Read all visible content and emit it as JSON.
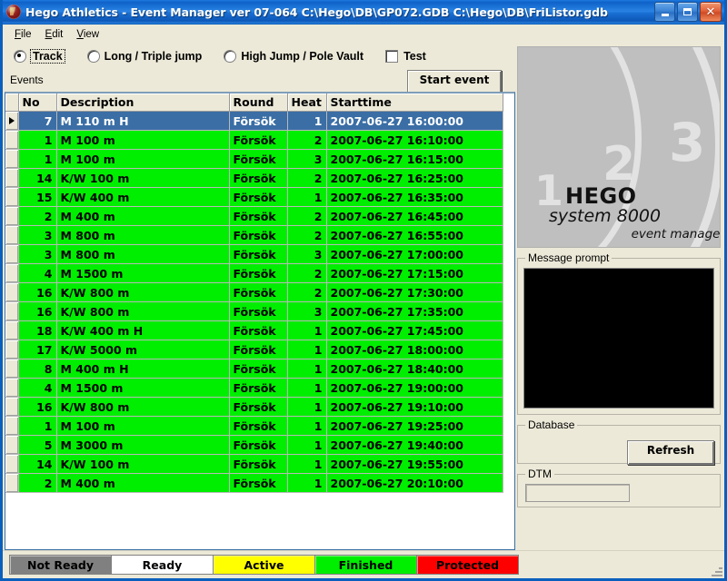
{
  "window": {
    "title": "Hego Athletics - Event Manager ver 07-064  C:\\Hego\\DB\\GP072.GDB C:\\Hego\\DB\\FriListor.gdb",
    "icon": "hego-app-icon",
    "minimize_label": "",
    "maximize_label": "",
    "close_label": "✕",
    "titlebar_color": "#1569cf",
    "frame_color": "#0a5fbd"
  },
  "menu": {
    "items": [
      {
        "label": "File",
        "accel": "F",
        "rest": "ile"
      },
      {
        "label": "Edit",
        "accel": "E",
        "rest": "dit"
      },
      {
        "label": "View",
        "accel": "V",
        "rest": "iew"
      }
    ]
  },
  "options": {
    "radios": [
      {
        "label": "Track",
        "selected": true,
        "focused": true
      },
      {
        "label": "Long / Triple jump",
        "selected": false,
        "focused": false
      },
      {
        "label": "High Jump / Pole Vault",
        "selected": false,
        "focused": false
      }
    ],
    "checkbox": {
      "label": "Test",
      "checked": false
    }
  },
  "events_panel": {
    "label": "Events",
    "start_button": "Start event"
  },
  "grid": {
    "columns": [
      "No",
      "Description",
      "Round",
      "Heat",
      "Starttime"
    ],
    "selected_row_index": 0,
    "selected_color": "#3a6ea5",
    "row_color": "#00ee00",
    "rows": [
      {
        "no": "7",
        "description": "M 110 m H",
        "round": "Försök",
        "heat": "1",
        "starttime": "2007-06-27 16:00:00"
      },
      {
        "no": "1",
        "description": "M 100 m",
        "round": "Försök",
        "heat": "2",
        "starttime": "2007-06-27 16:10:00"
      },
      {
        "no": "1",
        "description": "M 100 m",
        "round": "Försök",
        "heat": "3",
        "starttime": "2007-06-27 16:15:00"
      },
      {
        "no": "14",
        "description": "K/W 100 m",
        "round": "Försök",
        "heat": "2",
        "starttime": "2007-06-27 16:25:00"
      },
      {
        "no": "15",
        "description": "K/W 400 m",
        "round": "Försök",
        "heat": "1",
        "starttime": "2007-06-27 16:35:00"
      },
      {
        "no": "2",
        "description": "M 400 m",
        "round": "Försök",
        "heat": "2",
        "starttime": "2007-06-27 16:45:00"
      },
      {
        "no": "3",
        "description": "M 800 m",
        "round": "Försök",
        "heat": "2",
        "starttime": "2007-06-27 16:55:00"
      },
      {
        "no": "3",
        "description": "M 800 m",
        "round": "Försök",
        "heat": "3",
        "starttime": "2007-06-27 17:00:00"
      },
      {
        "no": "4",
        "description": "M 1500 m",
        "round": "Försök",
        "heat": "2",
        "starttime": "2007-06-27 17:15:00"
      },
      {
        "no": "16",
        "description": "K/W 800 m",
        "round": "Försök",
        "heat": "2",
        "starttime": "2007-06-27 17:30:00"
      },
      {
        "no": "16",
        "description": "K/W 800 m",
        "round": "Försök",
        "heat": "3",
        "starttime": "2007-06-27 17:35:00"
      },
      {
        "no": "18",
        "description": "K/W 400 m H",
        "round": "Försök",
        "heat": "1",
        "starttime": "2007-06-27 17:45:00"
      },
      {
        "no": "17",
        "description": "K/W 5000 m",
        "round": "Försök",
        "heat": "1",
        "starttime": "2007-06-27 18:00:00"
      },
      {
        "no": "8",
        "description": "M 400 m H",
        "round": "Försök",
        "heat": "1",
        "starttime": "2007-06-27 18:40:00"
      },
      {
        "no": "4",
        "description": "M 1500 m",
        "round": "Försök",
        "heat": "1",
        "starttime": "2007-06-27 19:00:00"
      },
      {
        "no": "16",
        "description": "K/W 800 m",
        "round": "Försök",
        "heat": "1",
        "starttime": "2007-06-27 19:10:00"
      },
      {
        "no": "1",
        "description": "M 100 m",
        "round": "Försök",
        "heat": "1",
        "starttime": "2007-06-27 19:25:00"
      },
      {
        "no": "5",
        "description": "M 3000 m",
        "round": "Försök",
        "heat": "1",
        "starttime": "2007-06-27 19:40:00"
      },
      {
        "no": "14",
        "description": "K/W 100 m",
        "round": "Försök",
        "heat": "1",
        "starttime": "2007-06-27 19:55:00"
      },
      {
        "no": "2",
        "description": "M 400 m",
        "round": "Försök",
        "heat": "1",
        "starttime": "2007-06-27 20:10:00"
      }
    ]
  },
  "logo": {
    "brand": "HEGO",
    "system": "system 8000",
    "product": "event manager",
    "lane_numbers": [
      "1",
      "2",
      "3"
    ],
    "background_color": "#bfbfbf"
  },
  "message_prompt": {
    "legend": "Message prompt",
    "content": ""
  },
  "database": {
    "legend": "Database",
    "refresh_button": "Refresh"
  },
  "dtm": {
    "legend": "DTM",
    "value": ""
  },
  "status_legend": {
    "items": [
      {
        "label": "Not Ready",
        "bg": "#808080",
        "fg": "#000000"
      },
      {
        "label": "Ready",
        "bg": "#ffffff",
        "fg": "#000000"
      },
      {
        "label": "Active",
        "bg": "#ffff00",
        "fg": "#000000"
      },
      {
        "label": "Finished",
        "bg": "#00ee00",
        "fg": "#000000"
      },
      {
        "label": "Protected",
        "bg": "#ff0000",
        "fg": "#000000"
      }
    ]
  }
}
